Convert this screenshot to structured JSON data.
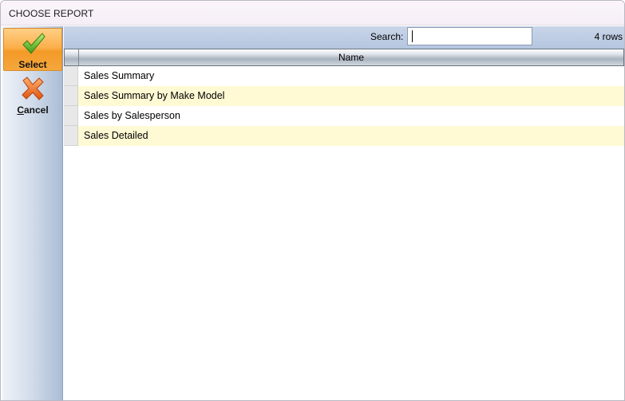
{
  "window": {
    "title": "CHOOSE REPORT"
  },
  "sidebar": {
    "select": {
      "label": "Select",
      "icon": "checkmark-icon"
    },
    "cancel": {
      "label": "Cancel",
      "icon": "cancel-x-icon"
    }
  },
  "toolbar": {
    "search_label": "Search:",
    "search_value": "",
    "row_count": "4 rows"
  },
  "grid": {
    "columns": [
      "Name"
    ],
    "rows": [
      {
        "name": "Sales Summary"
      },
      {
        "name": "Sales Summary by Make Model"
      },
      {
        "name": "Sales by Salesperson"
      },
      {
        "name": "Sales Detailed"
      }
    ]
  },
  "colors": {
    "select_button": "#f7a53a",
    "alt_row": "#fff9d4",
    "toolbar": "#b5c6df"
  }
}
